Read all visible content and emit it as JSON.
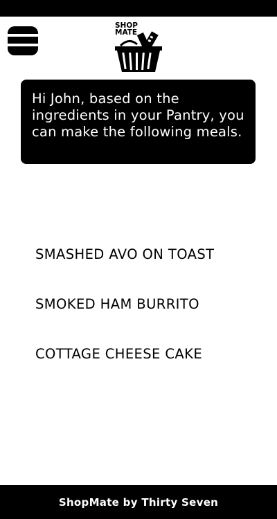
{
  "app": {
    "logo_line1": "SHOP",
    "logo_line2": "MATE"
  },
  "header": {
    "menu_icon": "hamburger-menu-icon",
    "logo_icon": "shopping-basket-icon"
  },
  "message": {
    "text": "Hi John, based on the ingredients in your Pantry, you can make the following meals."
  },
  "meals": [
    {
      "label": "SMASHED AVO ON TOAST"
    },
    {
      "label": "SMOKED HAM BURRITO"
    },
    {
      "label": "COTTAGE CHEESE CAKE"
    }
  ],
  "footer": {
    "text": "ShopMate by Thirty Seven"
  },
  "colors": {
    "background": "#ffffff",
    "primary": "#000000",
    "on_primary": "#ffffff"
  }
}
